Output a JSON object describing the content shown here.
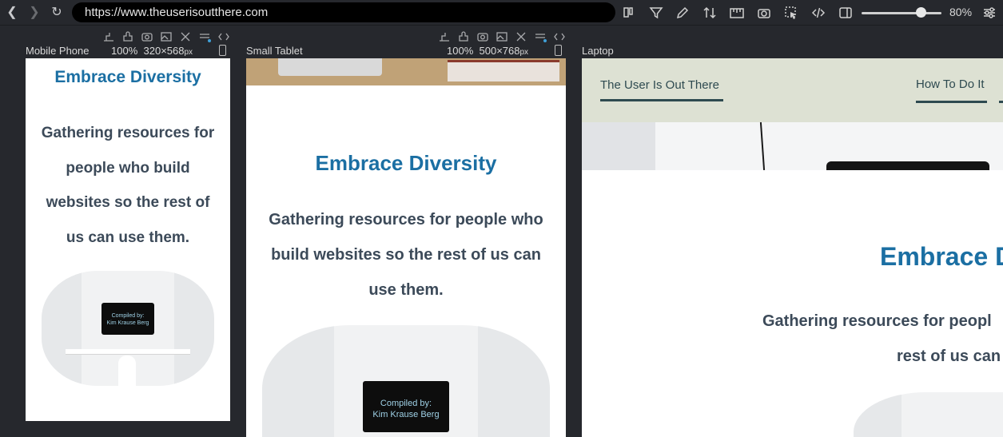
{
  "browser": {
    "url": "https://www.theuserisoutthere.com",
    "zoom": "80%"
  },
  "devices": [
    {
      "label": "Mobile Phone",
      "scale": "100%",
      "width": "320",
      "sep": "×",
      "height": "568",
      "unit": "px"
    },
    {
      "label": "Small Tablet",
      "scale": "100%",
      "width": "500",
      "sep": "×",
      "height": "768",
      "unit": "px"
    },
    {
      "label": "Laptop"
    }
  ],
  "site": {
    "heading": "Embrace Diversity",
    "tagline": "Gathering resources for people who build websites so the rest of us can use them.",
    "monitor_line1": "Compiled by:",
    "monitor_line2": "Kim Krause Berg",
    "brand": "The User Is Out There",
    "nav_item": "How To Do It",
    "laptop_heading": "Embrace D",
    "laptop_tagline_line1": "Gathering resources for peopl",
    "laptop_tagline_line2": "rest of us can"
  },
  "colors": {
    "accent": "#1b6fa3",
    "text": "#3c4a59",
    "header_bg": "#dde1d3",
    "nav_underline": "#2e4a50"
  },
  "icons": [
    "back-icon",
    "forward-icon",
    "reload-icon",
    "layout-icon",
    "filter-icon",
    "pen-icon",
    "sort-icon",
    "ruler-icon",
    "camera-icon",
    "cursor-icon",
    "code-icon",
    "sidebar-icon",
    "settings-icon"
  ]
}
